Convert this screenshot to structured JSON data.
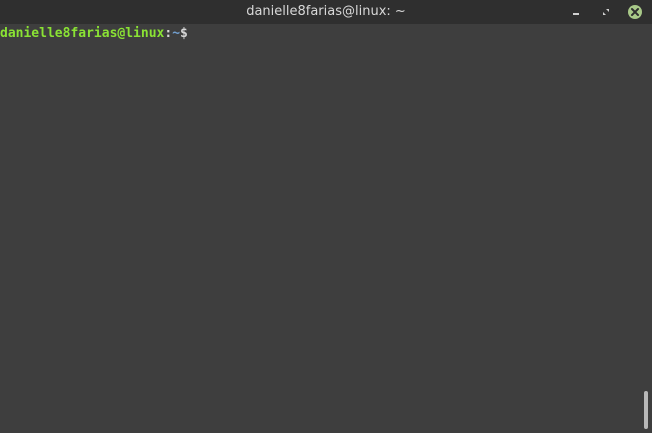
{
  "window": {
    "title": "danielle8farias@linux: ~"
  },
  "terminal": {
    "prompt": {
      "user_host": "danielle8farias@linux",
      "colon": ":",
      "directory": "~",
      "symbol": "$"
    },
    "colors": {
      "background": "#3e3e3e",
      "user_host": "#8ae234",
      "directory": "#729fcf",
      "text": "#d6d6d6"
    }
  },
  "titlebar_icons": [
    "minimize-icon",
    "maximize-icon",
    "close-icon"
  ]
}
